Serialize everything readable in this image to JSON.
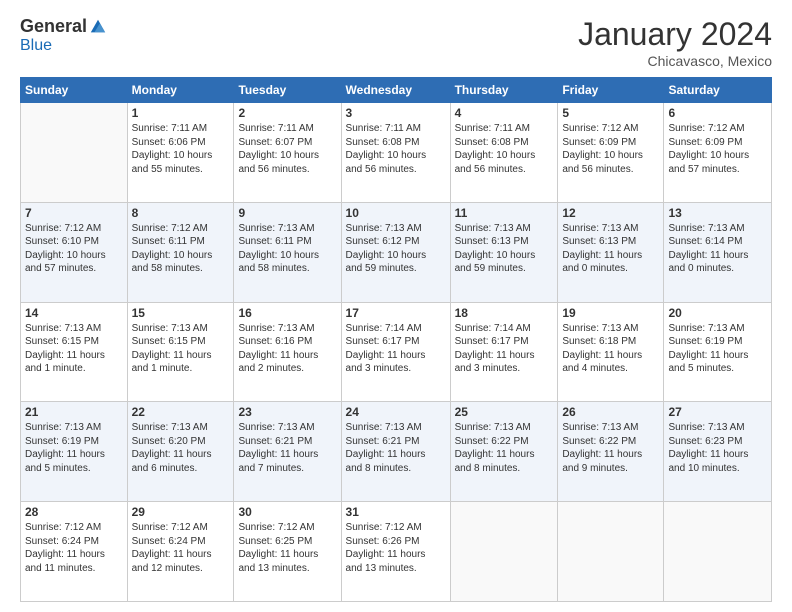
{
  "header": {
    "logo_general": "General",
    "logo_blue": "Blue",
    "month_title": "January 2024",
    "location": "Chicavasco, Mexico"
  },
  "days_of_week": [
    "Sunday",
    "Monday",
    "Tuesday",
    "Wednesday",
    "Thursday",
    "Friday",
    "Saturday"
  ],
  "weeks": [
    [
      {
        "day": "",
        "info": ""
      },
      {
        "day": "1",
        "info": "Sunrise: 7:11 AM\nSunset: 6:06 PM\nDaylight: 10 hours\nand 55 minutes."
      },
      {
        "day": "2",
        "info": "Sunrise: 7:11 AM\nSunset: 6:07 PM\nDaylight: 10 hours\nand 56 minutes."
      },
      {
        "day": "3",
        "info": "Sunrise: 7:11 AM\nSunset: 6:08 PM\nDaylight: 10 hours\nand 56 minutes."
      },
      {
        "day": "4",
        "info": "Sunrise: 7:11 AM\nSunset: 6:08 PM\nDaylight: 10 hours\nand 56 minutes."
      },
      {
        "day": "5",
        "info": "Sunrise: 7:12 AM\nSunset: 6:09 PM\nDaylight: 10 hours\nand 56 minutes."
      },
      {
        "day": "6",
        "info": "Sunrise: 7:12 AM\nSunset: 6:09 PM\nDaylight: 10 hours\nand 57 minutes."
      }
    ],
    [
      {
        "day": "7",
        "info": "Sunrise: 7:12 AM\nSunset: 6:10 PM\nDaylight: 10 hours\nand 57 minutes."
      },
      {
        "day": "8",
        "info": "Sunrise: 7:12 AM\nSunset: 6:11 PM\nDaylight: 10 hours\nand 58 minutes."
      },
      {
        "day": "9",
        "info": "Sunrise: 7:13 AM\nSunset: 6:11 PM\nDaylight: 10 hours\nand 58 minutes."
      },
      {
        "day": "10",
        "info": "Sunrise: 7:13 AM\nSunset: 6:12 PM\nDaylight: 10 hours\nand 59 minutes."
      },
      {
        "day": "11",
        "info": "Sunrise: 7:13 AM\nSunset: 6:13 PM\nDaylight: 10 hours\nand 59 minutes."
      },
      {
        "day": "12",
        "info": "Sunrise: 7:13 AM\nSunset: 6:13 PM\nDaylight: 11 hours\nand 0 minutes."
      },
      {
        "day": "13",
        "info": "Sunrise: 7:13 AM\nSunset: 6:14 PM\nDaylight: 11 hours\nand 0 minutes."
      }
    ],
    [
      {
        "day": "14",
        "info": "Sunrise: 7:13 AM\nSunset: 6:15 PM\nDaylight: 11 hours\nand 1 minute."
      },
      {
        "day": "15",
        "info": "Sunrise: 7:13 AM\nSunset: 6:15 PM\nDaylight: 11 hours\nand 1 minute."
      },
      {
        "day": "16",
        "info": "Sunrise: 7:13 AM\nSunset: 6:16 PM\nDaylight: 11 hours\nand 2 minutes."
      },
      {
        "day": "17",
        "info": "Sunrise: 7:14 AM\nSunset: 6:17 PM\nDaylight: 11 hours\nand 3 minutes."
      },
      {
        "day": "18",
        "info": "Sunrise: 7:14 AM\nSunset: 6:17 PM\nDaylight: 11 hours\nand 3 minutes."
      },
      {
        "day": "19",
        "info": "Sunrise: 7:13 AM\nSunset: 6:18 PM\nDaylight: 11 hours\nand 4 minutes."
      },
      {
        "day": "20",
        "info": "Sunrise: 7:13 AM\nSunset: 6:19 PM\nDaylight: 11 hours\nand 5 minutes."
      }
    ],
    [
      {
        "day": "21",
        "info": "Sunrise: 7:13 AM\nSunset: 6:19 PM\nDaylight: 11 hours\nand 5 minutes."
      },
      {
        "day": "22",
        "info": "Sunrise: 7:13 AM\nSunset: 6:20 PM\nDaylight: 11 hours\nand 6 minutes."
      },
      {
        "day": "23",
        "info": "Sunrise: 7:13 AM\nSunset: 6:21 PM\nDaylight: 11 hours\nand 7 minutes."
      },
      {
        "day": "24",
        "info": "Sunrise: 7:13 AM\nSunset: 6:21 PM\nDaylight: 11 hours\nand 8 minutes."
      },
      {
        "day": "25",
        "info": "Sunrise: 7:13 AM\nSunset: 6:22 PM\nDaylight: 11 hours\nand 8 minutes."
      },
      {
        "day": "26",
        "info": "Sunrise: 7:13 AM\nSunset: 6:22 PM\nDaylight: 11 hours\nand 9 minutes."
      },
      {
        "day": "27",
        "info": "Sunrise: 7:13 AM\nSunset: 6:23 PM\nDaylight: 11 hours\nand 10 minutes."
      }
    ],
    [
      {
        "day": "28",
        "info": "Sunrise: 7:12 AM\nSunset: 6:24 PM\nDaylight: 11 hours\nand 11 minutes."
      },
      {
        "day": "29",
        "info": "Sunrise: 7:12 AM\nSunset: 6:24 PM\nDaylight: 11 hours\nand 12 minutes."
      },
      {
        "day": "30",
        "info": "Sunrise: 7:12 AM\nSunset: 6:25 PM\nDaylight: 11 hours\nand 13 minutes."
      },
      {
        "day": "31",
        "info": "Sunrise: 7:12 AM\nSunset: 6:26 PM\nDaylight: 11 hours\nand 13 minutes."
      },
      {
        "day": "",
        "info": ""
      },
      {
        "day": "",
        "info": ""
      },
      {
        "day": "",
        "info": ""
      }
    ]
  ]
}
